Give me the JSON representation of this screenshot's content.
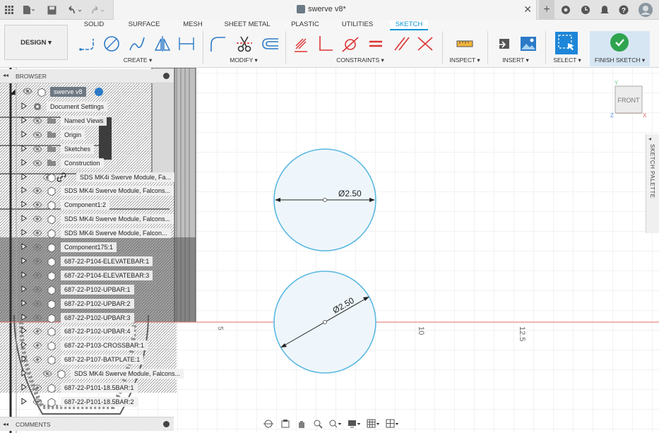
{
  "window": {
    "title": "swerve v8*"
  },
  "workspace_tabs": [
    "SOLID",
    "SURFACE",
    "MESH",
    "SHEET METAL",
    "PLASTIC",
    "UTILITIES",
    "SKETCH"
  ],
  "active_tab": "SKETCH",
  "design_button": "DESIGN ▾",
  "groups": {
    "create": "CREATE ▾",
    "modify": "MODIFY ▾",
    "constraints": "CONSTRAINTS ▾",
    "inspect": "INSPECT ▾",
    "insert": "INSERT ▾",
    "select": "SELECT ▾",
    "finish": "FINISH SKETCH ▾"
  },
  "browser": {
    "header": "BROWSER",
    "root": "swerve v8",
    "items": [
      {
        "label": "Document Settings",
        "icon": "gear-icon"
      },
      {
        "label": "Named Views",
        "icon": "folder-icon"
      },
      {
        "label": "Origin",
        "icon": "folder-icon"
      },
      {
        "label": "Sketches",
        "icon": "folder-icon"
      },
      {
        "label": "Construction",
        "icon": "folder-icon"
      },
      {
        "label": "SDS MK4i Swerve Module, Fa...",
        "icon": "link-icon"
      },
      {
        "label": "SDS MK4i Swerve Module, Falcons...",
        "icon": "component-icon"
      },
      {
        "label": "Component1:2",
        "icon": "component-icon"
      },
      {
        "label": "SDS MK4i Swerve Module, Falcons...",
        "icon": "component-icon"
      },
      {
        "label": "SDS MK4i Swerve Module, Falcon...",
        "icon": "component-icon"
      },
      {
        "label": "Component175:1",
        "icon": "component-icon"
      },
      {
        "label": "687-22-P104-ELEVATEBAR:1",
        "icon": "component-icon"
      },
      {
        "label": "687-22-P104-ELEVATEBAR:3",
        "icon": "component-icon"
      },
      {
        "label": "687-22-P102-UPBAR:1",
        "icon": "component-icon"
      },
      {
        "label": "687-22-P102-UPBAR:2",
        "icon": "component-icon"
      },
      {
        "label": "687-22-P102-UPBAR:3",
        "icon": "component-icon"
      },
      {
        "label": "687-22-P102-UPBAR:4",
        "icon": "component-icon"
      },
      {
        "label": "687-22-P103-CROSSBAR:1",
        "icon": "component-icon"
      },
      {
        "label": "687-22-P107-BATPLATE:1",
        "icon": "component-icon"
      },
      {
        "label": "SDS MK4i Swerve Module, Falcons...",
        "icon": "component-icon"
      },
      {
        "label": "687-22-P101-18.5BAR:1",
        "icon": "component-icon"
      },
      {
        "label": "687-22-P101-18.5BAR:2",
        "icon": "component-icon"
      }
    ]
  },
  "comments": "COMMENTS",
  "viewcube": {
    "face": "FRONT",
    "axes": {
      "y": "Y",
      "x": "X",
      "z": "Z"
    }
  },
  "sketch_palette": "SKETCH PALETTE",
  "dimensions": {
    "d1": "Ø2.50",
    "d2": "Ø2.50"
  },
  "ruler": {
    "r5": "5",
    "r10": "10",
    "r125": "12.5",
    "v5": "5"
  },
  "colors": {
    "accent": "#0696d7",
    "circle": "#5bb8e0",
    "fill": "#eef6fc",
    "red_axis": "#e26b6b"
  }
}
